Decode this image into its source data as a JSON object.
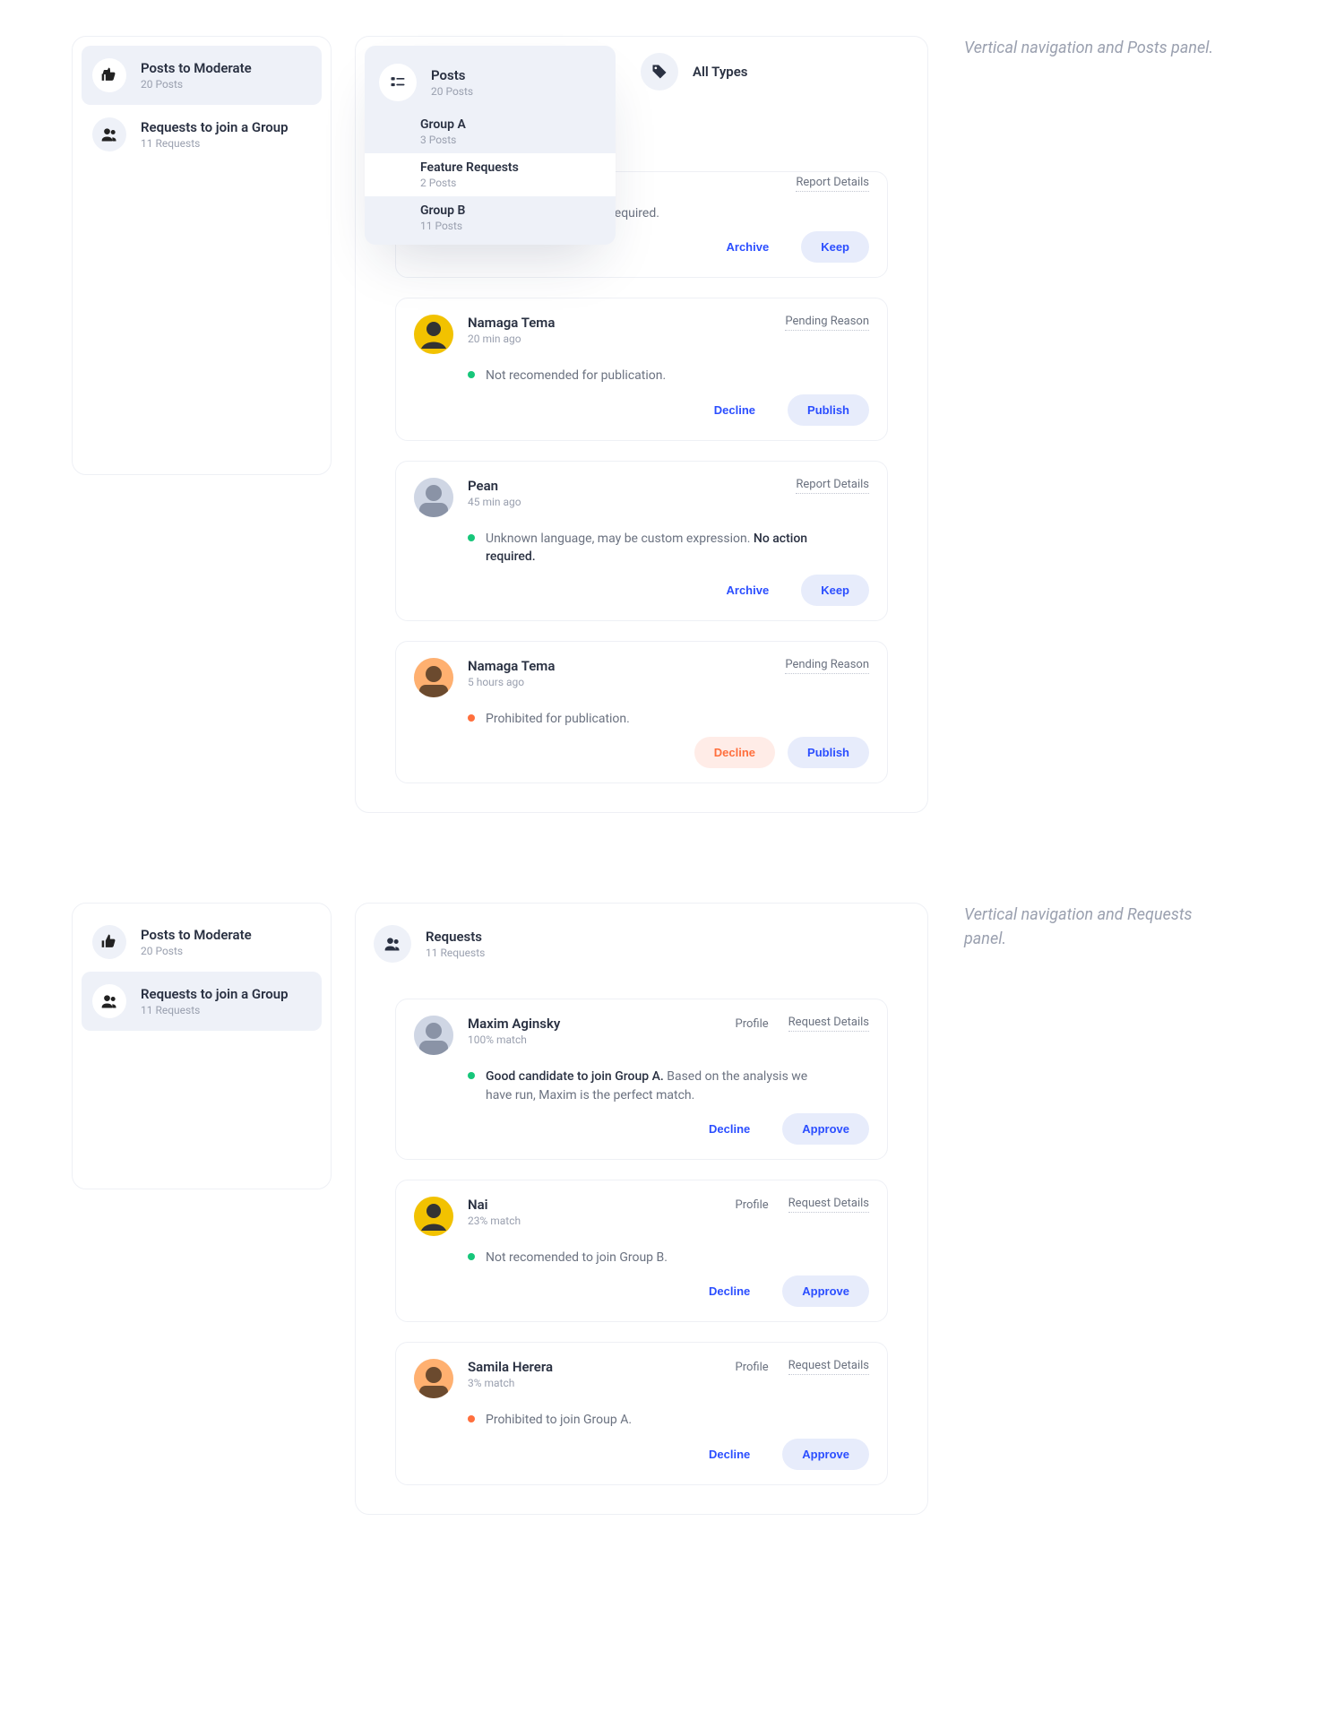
{
  "captions": {
    "posts": "Vertical navigation and Posts panel.",
    "requests": "Vertical navigation and Requests panel."
  },
  "sidebar": {
    "items": [
      {
        "title": "Posts to Moderate",
        "sub": "20 Posts",
        "icon": "thumbs"
      },
      {
        "title": "Requests to join a Group",
        "sub": "11 Requests",
        "icon": "people"
      }
    ]
  },
  "posts_panel": {
    "dropdown": {
      "title": "Posts",
      "sub": "20 Posts",
      "items": [
        {
          "title": "Group A",
          "sub": "3 Posts"
        },
        {
          "title": "Feature Requests",
          "sub": "2 Posts",
          "selected": true
        },
        {
          "title": "Group B",
          "sub": "11 Posts"
        }
      ]
    },
    "types_filter": {
      "label": "All Types"
    },
    "cards": [
      {
        "name": "(hidden)",
        "time": "(hidden)",
        "meta": "Report Details",
        "reason_visible": "on required.",
        "secondary": "Archive",
        "primary": "Keep",
        "dot": "green",
        "truncated": true
      },
      {
        "name": "Namaga Tema",
        "time": "20 min ago",
        "meta": "Pending Reason",
        "reason": "Not recomended for publication.",
        "secondary": "Decline",
        "primary": "Publish",
        "dot": "green",
        "avatar": "yellow"
      },
      {
        "name": "Pean",
        "time": "45 min ago",
        "meta": "Report Details",
        "reason_pre": "Unknown language, may be custom expression. ",
        "reason_strong": "No action required.",
        "secondary": "Archive",
        "primary": "Keep",
        "dot": "green",
        "avatar": "gray"
      },
      {
        "name": "Namaga Tema",
        "time": "5 hours ago",
        "meta": "Pending Reason",
        "reason": "Prohibited for publication.",
        "secondary": "Decline",
        "secondary_warn": true,
        "primary": "Publish",
        "dot": "orange",
        "avatar": "orange"
      }
    ]
  },
  "requests_panel": {
    "header": {
      "title": "Requests",
      "sub": "11 Requests"
    },
    "cards": [
      {
        "name": "Maxim Aginsky",
        "sub": "100% match",
        "meta1": "Profile",
        "meta2": "Request Details",
        "reason_strong": "Good candidate to join Group A.",
        "reason_post": " Based on the analysis we have run, Maxim is the perfect match.",
        "secondary": "Decline",
        "primary": "Approve",
        "dot": "green",
        "avatar": "gray"
      },
      {
        "name": "Nai",
        "sub": "23% match",
        "meta1": "Profile",
        "meta2": "Request Details",
        "reason": "Not recomended to join Group B.",
        "secondary": "Decline",
        "primary": "Approve",
        "dot": "green",
        "avatar": "yellow"
      },
      {
        "name": "Samila Herera",
        "sub": "3% match",
        "meta1": "Profile",
        "meta2": "Request Details",
        "reason": "Prohibited to join Group A.",
        "secondary": "Decline",
        "primary": "Approve",
        "dot": "orange",
        "avatar": "orange"
      }
    ]
  }
}
